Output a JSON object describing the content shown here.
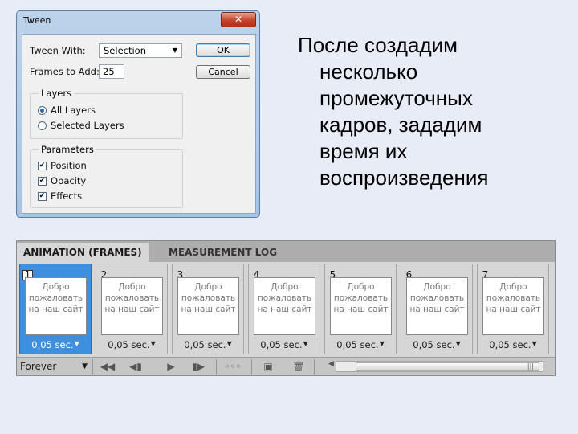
{
  "dialog": {
    "title": "Tween",
    "close_label": "✕",
    "tween_with_label": "Tween With:",
    "tween_with_value": "Selection",
    "frames_label": "Frames to Add:",
    "frames_value": "25",
    "ok_label": "OK",
    "cancel_label": "Cancel",
    "layers": {
      "legend": "Layers",
      "options": [
        {
          "label": "All Layers",
          "selected": true
        },
        {
          "label": "Selected Layers",
          "selected": false
        }
      ]
    },
    "parameters": {
      "legend": "Parameters",
      "options": [
        {
          "label": "Position",
          "checked": true
        },
        {
          "label": "Opacity",
          "checked": true
        },
        {
          "label": "Effects",
          "checked": true
        }
      ]
    }
  },
  "slide": {
    "lines": [
      "После создадим",
      "несколько",
      "промежуточных",
      "кадров, зададим",
      "время их",
      "воспроизведения"
    ]
  },
  "animation": {
    "tabs": [
      "ANIMATION (FRAMES)",
      "MEASUREMENT LOG"
    ],
    "thumb_text": [
      "Добро",
      "пожаловать",
      "на наш сайт"
    ],
    "frames": [
      {
        "num": "1",
        "delay": "0,05 sec.",
        "selected": true
      },
      {
        "num": "2",
        "delay": "0,05 sec.",
        "selected": false
      },
      {
        "num": "3",
        "delay": "0,05 sec.",
        "selected": false
      },
      {
        "num": "4",
        "delay": "0,05 sec.",
        "selected": false
      },
      {
        "num": "5",
        "delay": "0,05 sec.",
        "selected": false
      },
      {
        "num": "6",
        "delay": "0,05 sec.",
        "selected": false
      },
      {
        "num": "7",
        "delay": "0,05 sec.",
        "selected": false
      }
    ],
    "loop_value": "Forever",
    "controls": {
      "first": "◀◀",
      "prev": "◀▮",
      "play": "▶",
      "next": "▮▶",
      "tween": "◦◦◦",
      "new_frame": "▣",
      "delete": "🗑",
      "scroll_left": "◀",
      "scroll_grip": "|||"
    }
  }
}
